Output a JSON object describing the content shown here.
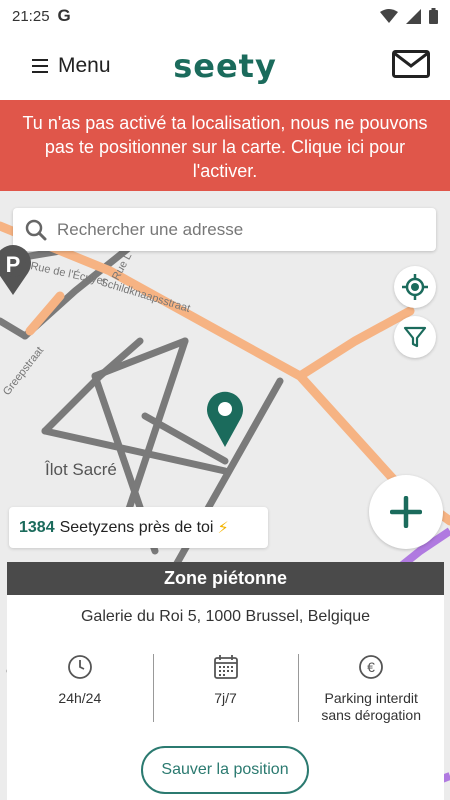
{
  "status_bar": {
    "time": "21:25",
    "g_label": "G"
  },
  "app_bar": {
    "menu_label": "Menu",
    "logo": "seety"
  },
  "banner": {
    "text": "Tu n'as pas activé ta localisation, nous ne pouvons pas te positionner sur la carte. Clique ici pour l'activer."
  },
  "search": {
    "placeholder": "Rechercher une adresse"
  },
  "map": {
    "street_labels": [
      "Schildknaapsstraat",
      "Greepstraat",
      "Rue de l'Écuyer",
      "Rue L"
    ],
    "place_label": "Îlot Sacré",
    "parking_letter": "P"
  },
  "counter": {
    "count": "1384",
    "text": "Seetyzens près de toi",
    "emoji": "⚡"
  },
  "zone": {
    "title": "Zone piétonne",
    "address": "Galerie du Roi 5, 1000 Brussel, Belgique",
    "info": [
      {
        "icon": "clock-icon",
        "label": "24h/24"
      },
      {
        "icon": "calendar-icon",
        "label": "7j/7"
      },
      {
        "icon": "euro-icon",
        "label": "Parking interdit\nsans dérogation"
      }
    ],
    "save_label": "Sauver la position"
  },
  "colors": {
    "brand": "#1b6b5c",
    "banner": "#e0564a",
    "header": "#4a4a4a",
    "road_major": "#f6b383"
  }
}
